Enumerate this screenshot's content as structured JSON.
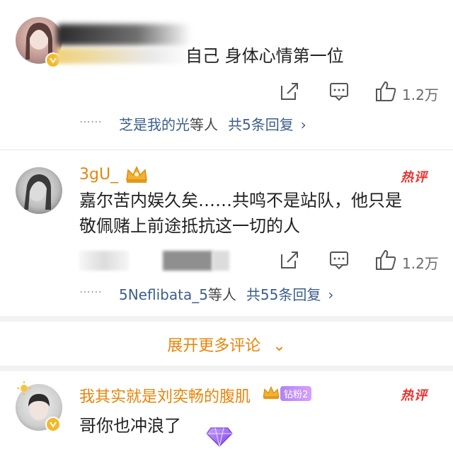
{
  "comments": [
    {
      "text": "自己 身体心情第一位",
      "likes": "1.2万",
      "replies_prefix": "⋯⋯",
      "replies_user": "芝是我的光",
      "replies_suffix": "等人",
      "replies_total": "共5条回复",
      "replies_chevron": "›"
    },
    {
      "username": "3gU_",
      "hot_badge": "热评",
      "text_line1": "嘉尔苦内娱久矣……共鸣不是站队，他只是",
      "text_line2": "敬佩赌上前途抵抗这一切的人",
      "likes": "1.2万",
      "replies_prefix": "⋯⋯",
      "replies_user": "5Neflibata_5",
      "replies_suffix": "等人",
      "replies_total": "共55条回复",
      "replies_chevron": "›"
    },
    {
      "username": "我其实就是刘奕畅的腹肌",
      "fan_badge": "钻粉2",
      "hot_badge": "热评",
      "text": "哥你也冲浪了"
    }
  ],
  "expand_more": "展开更多评论",
  "expand_chevron": "⌄",
  "colors": {
    "username": "#e8850a",
    "link": "#3b5e8c",
    "hot": "#e8322f"
  },
  "icons": [
    "share-icon",
    "comment-icon",
    "like-icon",
    "vip-badge-icon",
    "crown-icon",
    "gem-icon"
  ]
}
